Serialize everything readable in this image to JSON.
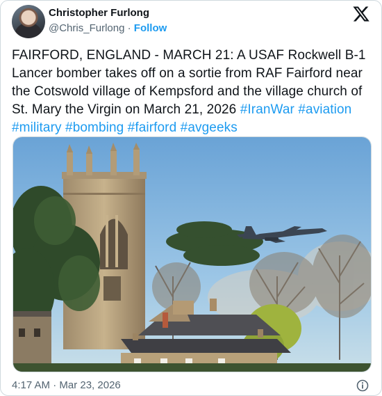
{
  "author": {
    "display_name": "Christopher Furlong",
    "handle": "@Chris_Furlong",
    "separator": "·",
    "follow_label": "Follow"
  },
  "post": {
    "body_text": "FAIRFORD, ENGLAND - MARCH 21: A USAF Rockwell B-1 Lancer bomber takes off on a sortie from RAF Fairford near the Cotswold village of Kempsford and the village church of St. Mary the Virgin on March 21, 2026 ",
    "hashtags": [
      "#IranWar",
      "#aviation",
      "#military",
      "#bombing",
      "#fairford",
      "#avgeeks"
    ],
    "timestamp": "4:17 AM · Mar 23, 2026"
  },
  "icons": {
    "brand": "x-logo-icon",
    "info": "info-icon"
  },
  "colors": {
    "link": "#1d9bf0",
    "text": "#0f1419",
    "secondary": "#536471",
    "border": "#cfd9de"
  }
}
